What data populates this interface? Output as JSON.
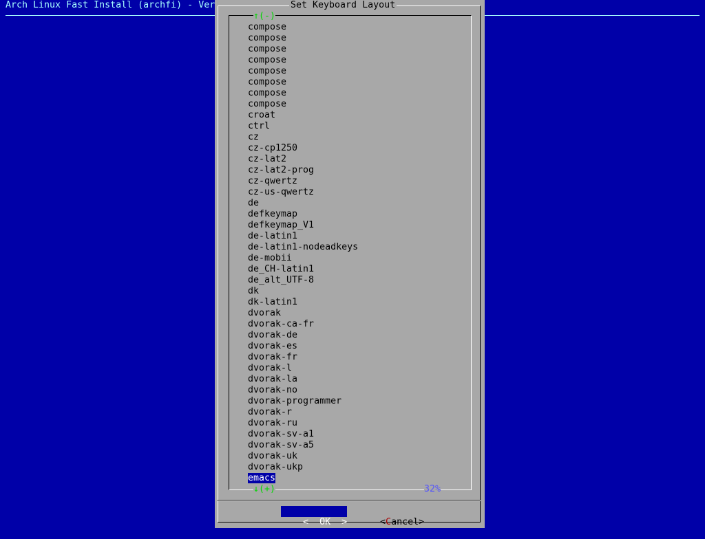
{
  "screen": {
    "backtitle": "Arch Linux Fast Install (archfi) - Ver",
    "colors": {
      "background": "#0000a8",
      "dialog": "#a8a8a8",
      "accent_text": "#a8ffff",
      "scroll_indicator": "#00d800",
      "percent": "#5454fc",
      "selected_bg": "#0000a8"
    }
  },
  "dialog": {
    "title": "Set Keyboard Layout",
    "scroll_up_label": "↑(-)",
    "scroll_down_label": "↓(+)",
    "scroll_percent": "32%",
    "items": [
      "compose",
      "compose",
      "compose",
      "compose",
      "compose",
      "compose",
      "compose",
      "compose",
      "croat",
      "ctrl",
      "cz",
      "cz-cp1250",
      "cz-lat2",
      "cz-lat2-prog",
      "cz-qwertz",
      "cz-us-qwertz",
      "de",
      "defkeymap",
      "defkeymap_V1",
      "de-latin1",
      "de-latin1-nodeadkeys",
      "de-mobii",
      "de_CH-latin1",
      "de_alt_UTF-8",
      "dk",
      "dk-latin1",
      "dvorak",
      "dvorak-ca-fr",
      "dvorak-de",
      "dvorak-es",
      "dvorak-fr",
      "dvorak-l",
      "dvorak-la",
      "dvorak-no",
      "dvorak-programmer",
      "dvorak-r",
      "dvorak-ru",
      "dvorak-sv-a1",
      "dvorak-sv-a5",
      "dvorak-uk",
      "dvorak-ukp",
      "emacs"
    ],
    "selected_item": "emacs"
  },
  "buttons": {
    "ok": {
      "left": "<",
      "key": "O",
      "rest": "K",
      "right": ">"
    },
    "cancel": {
      "left": "<",
      "key": "C",
      "rest": "ancel",
      "right": ">"
    }
  }
}
